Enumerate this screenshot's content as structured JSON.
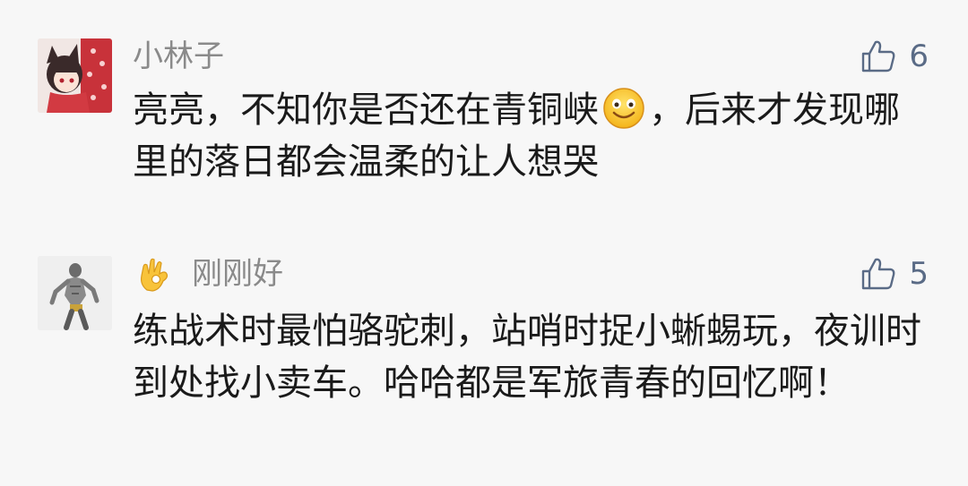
{
  "comments": [
    {
      "avatar_icon": "anime-cat-girl-avatar",
      "username": "小林子",
      "likes": "6",
      "text_before_emoji": "亮亮，不知你是否还在青铜峡",
      "emoji": "smile-emoji",
      "text_after_emoji": "，后来才发现哪里的落日都会温柔的让人想哭"
    },
    {
      "avatar_icon": "muscular-man-avatar",
      "name_emoji": "ok-hand-emoji",
      "username": "刚刚好",
      "likes": "5",
      "text": "练战术时最怕骆驼刺，站哨时捉小蜥蜴玩，夜训时到处找小卖车。哈哈都是军旅青春的回忆啊！"
    }
  ],
  "colors": {
    "background": "#f7f7f7",
    "username": "#8a8a8a",
    "like_icon": "#5a6b86",
    "text": "#1a1a1a"
  }
}
